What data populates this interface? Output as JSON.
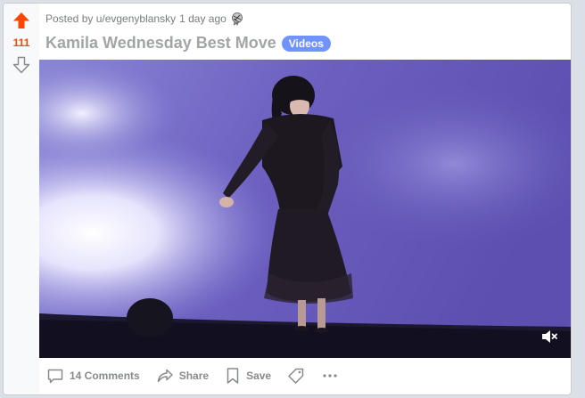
{
  "post": {
    "score": "111",
    "posted_by": "Posted by u/evgenyblansky",
    "time_ago": "1 day ago",
    "title": "Kamila Wednesday Best Move",
    "flair": "Videos",
    "flair_color": "#7193ff",
    "upvote_color": "#ff4500"
  },
  "actions": {
    "comments_label": "14 Comments",
    "share_label": "Share",
    "save_label": "Save"
  },
  "icons": {
    "upvote": "arrow-up-icon",
    "downvote": "arrow-down-icon",
    "award": "award-icon",
    "mute": "volume-muted-icon",
    "comments": "comment-bubble-icon",
    "share": "share-arrow-icon",
    "save": "bookmark-icon",
    "tag": "tag-icon",
    "more": "more-dots-icon"
  }
}
